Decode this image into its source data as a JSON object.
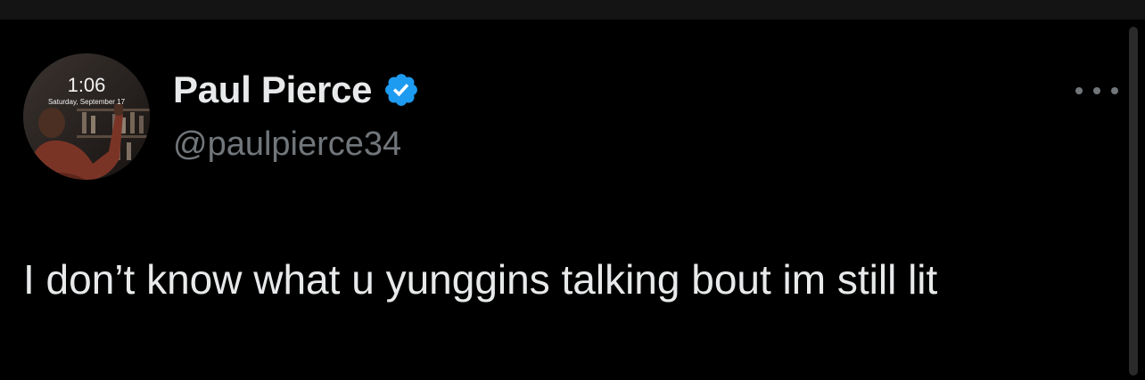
{
  "tweet": {
    "author": {
      "display_name": "Paul Pierce",
      "handle": "@paulpierce34",
      "verified": true,
      "verified_color": "#1d9bf0"
    },
    "avatar": {
      "time": "1:06",
      "date": "Saturday, September 17"
    },
    "text": "I don’t know what u yunggins talking bout im still lit",
    "more_icon": "more-horizontal-icon"
  },
  "colors": {
    "background": "#000000",
    "primary_text": "#e7e9ea",
    "secondary_text": "#71767b"
  }
}
